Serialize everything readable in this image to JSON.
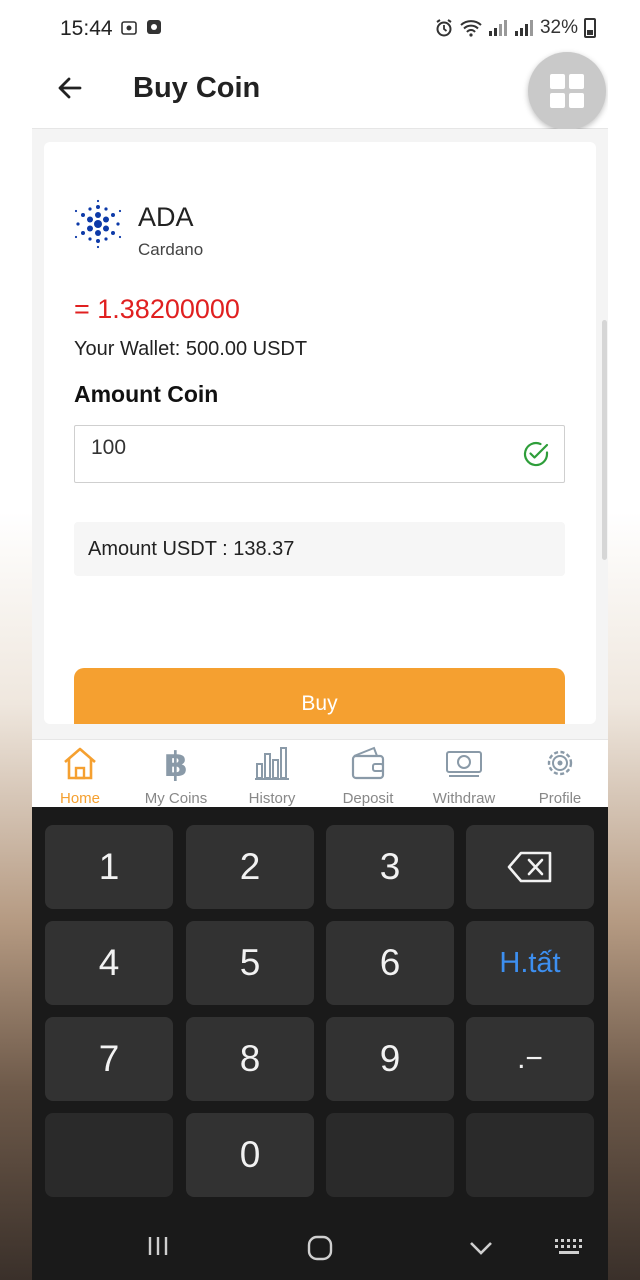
{
  "status_bar": {
    "time": "15:44",
    "battery": "32%"
  },
  "app_bar": {
    "title": "Buy Coin",
    "back_icon": "arrow-left-icon",
    "menu_icon": "grid-icon"
  },
  "coin": {
    "symbol": "ADA",
    "name": "Cardano",
    "price": "= 1.38200000",
    "wallet": "Your Wallet: 500.00 USDT"
  },
  "form": {
    "amount_label": "Amount Coin",
    "amount_value": "100",
    "amount_usdt": "Amount USDT : 138.37",
    "buy_label": "Buy"
  },
  "bottom_nav": [
    {
      "label": "Home",
      "icon": "home-icon",
      "active": true
    },
    {
      "label": "My Coins",
      "icon": "bitcoin-icon",
      "active": false
    },
    {
      "label": "History",
      "icon": "bar-chart-icon",
      "active": false
    },
    {
      "label": "Deposit",
      "icon": "wallet-icon",
      "active": false
    },
    {
      "label": "Withdraw",
      "icon": "cash-icon",
      "active": false
    },
    {
      "label": "Profile",
      "icon": "gear-icon",
      "active": false
    }
  ],
  "keyboard": {
    "keys": [
      "1",
      "2",
      "3",
      "4",
      "5",
      "6",
      "7",
      "8",
      "9",
      "0"
    ],
    "done_label": "H.tất",
    "punct_label": ".−"
  },
  "colors": {
    "accent": "#f5a030",
    "price": "#e02020",
    "check": "#2e9e3a",
    "keyboard_bg": "#1a1a1a",
    "key_bg": "#323232",
    "done_key": "#3d8ff0"
  }
}
